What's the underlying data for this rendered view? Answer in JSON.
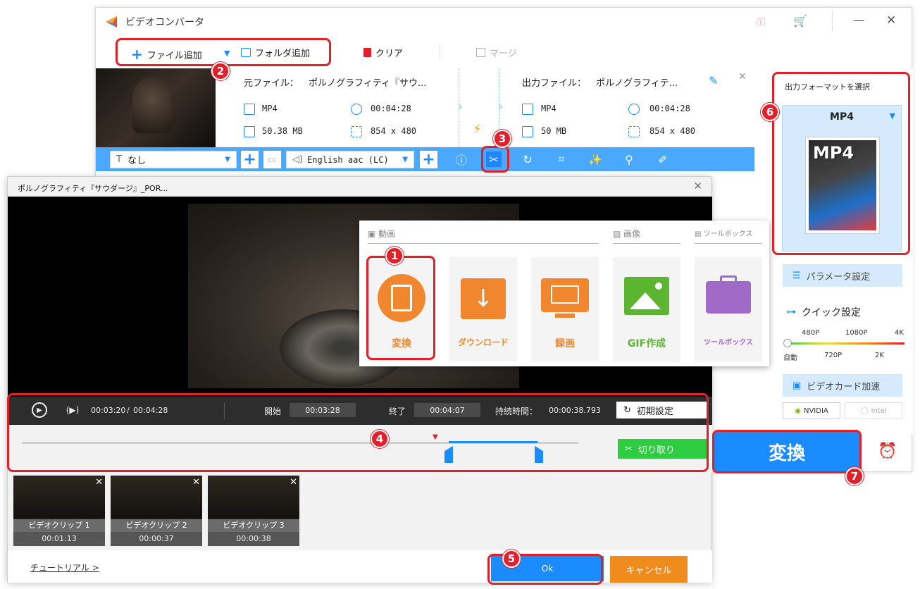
{
  "app": {
    "title": "ビデオコンバータ"
  },
  "toolbar": {
    "add_file": "ファイル追加",
    "add_folder": "フォルダ追加",
    "clear": "クリア",
    "merge": "マージ"
  },
  "file": {
    "source_label": "元ファイル：",
    "source_name": "ポルノグラフィティ『サウ...",
    "output_label": "出力ファイル：",
    "output_name": "ポルノグラフィテ...",
    "src_format": "MP4",
    "src_duration": "00:04:28",
    "src_size": "50.38 MB",
    "src_resolution": "854 x 480",
    "out_format": "MP4",
    "out_duration": "00:04:28",
    "out_size": "50 MB",
    "out_resolution": "854 x 480"
  },
  "editbar": {
    "subtitle_value": "なし",
    "cc": "cc",
    "audio_value": "English aac (LC)"
  },
  "right_panel": {
    "select_format_title": "出力フォーマットを選択",
    "format": "MP4",
    "format_logo": "MP4",
    "param_settings": "パラメータ設定",
    "quick_settings": "クイック設定",
    "quality_top": [
      "480P",
      "1080P",
      "4K"
    ],
    "quality_bottom": [
      "自動",
      "720P",
      "2K"
    ],
    "quality_level": 0,
    "gpu_accel": "ビデオカード加速",
    "nvidia": "NVIDIA",
    "intel": "Intel",
    "convert": "変換"
  },
  "dialog": {
    "title": "ポルノグラフィティ『サウダージ』_POR...",
    "current_time": "00:03:20",
    "time_sep": "/",
    "total_time": "00:04:28",
    "start_label": "開始",
    "start_value": "00:03:28",
    "end_label": "終了",
    "end_value": "00:04:07",
    "duration_label": "持続時間：",
    "duration_value": "00:00:38.793",
    "reset": "初期設定",
    "cut": "切り取り",
    "clips": [
      {
        "name": "ビデオクリップ 1",
        "duration": "00:01:13"
      },
      {
        "name": "ビデオクリップ 2",
        "duration": "00:00:37"
      },
      {
        "name": "ビデオクリップ 3",
        "duration": "00:00:38"
      }
    ],
    "tutorial": "チュートリアル >",
    "ok": "Ok",
    "cancel": "キャンセル"
  },
  "feature_popup": {
    "video_header": "動画",
    "image_header": "画像",
    "toolbox_header": "ツールボックス",
    "cards": [
      {
        "label": "変換",
        "color": "#f0872e"
      },
      {
        "label": "ダウンロード",
        "color": "#f0872e"
      },
      {
        "label": "録画",
        "color": "#f0872e"
      },
      {
        "label": "GIF作成",
        "color": "#5cb531"
      },
      {
        "label": "ツールボックス",
        "color": "#a06ac8"
      }
    ]
  },
  "badges": [
    "1",
    "2",
    "3",
    "4",
    "5",
    "6",
    "7"
  ],
  "colors": {
    "accent_blue": "#1a8cff",
    "annotation_red": "#e0202a",
    "cut_green": "#2ecc40",
    "cancel_orange": "#f08c1e"
  }
}
